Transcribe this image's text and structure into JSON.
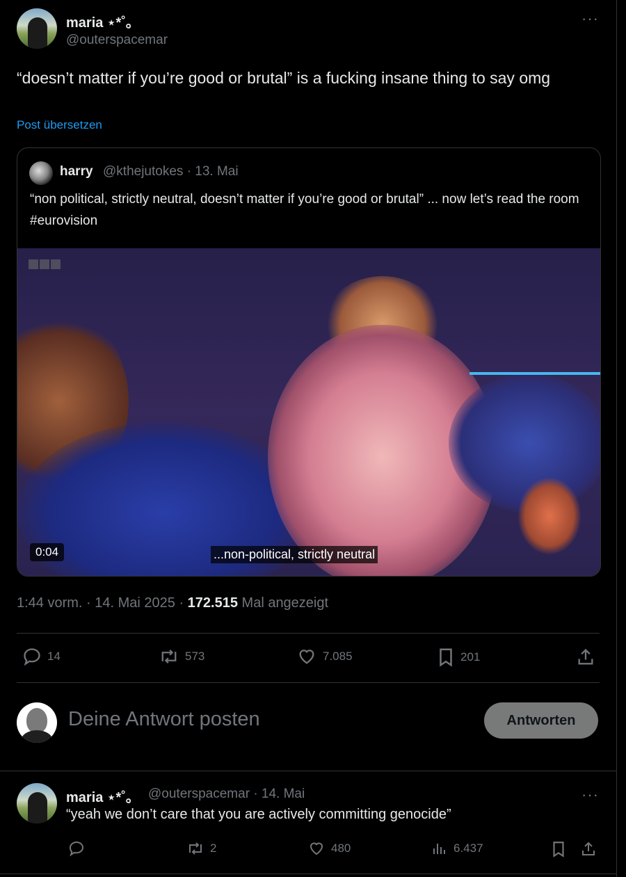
{
  "main_tweet": {
    "author_name": "maria ⋆*˚｡",
    "author_handle": "@outerspacemar",
    "text": "“doesn’t matter if you’re good or brutal” is a fucking insane thing to say omg",
    "translate_link": "Post übersetzen",
    "more_label": "···"
  },
  "quoted_tweet": {
    "author_name": "harry",
    "author_handle": "@kthejutokes",
    "date": "· 13. Mai",
    "text": "“non political, strictly neutral, doesn’t matter if you’re good or brutal” ... now let’s read the room #eurovision",
    "video_duration": "0:04",
    "video_subtitle": "...non-political, strictly neutral"
  },
  "meta": {
    "time": "1:44 vorm. · 14. Mai 2025 ·",
    "views": "172.515",
    "views_label": "Mal angezeigt"
  },
  "actions": {
    "replies": "14",
    "reposts": "573",
    "likes": "7.085",
    "bookmarks": "201"
  },
  "reply_box": {
    "placeholder": "Deine Antwort posten",
    "button_label": "Antworten"
  },
  "reply_tweet": {
    "author_name": "maria ⋆*˚｡",
    "author_handle": "@outerspacemar",
    "date": "· 14. Mai",
    "text": "“yeah we don’t care that you are actively committing genocide”",
    "reposts": "2",
    "likes": "480",
    "views": "6.437",
    "more_label": "···"
  },
  "colors": {
    "background": "#000000",
    "text": "#e7e9ea",
    "muted": "#71767b",
    "link": "#1d9bf0",
    "border": "#2f3336"
  }
}
